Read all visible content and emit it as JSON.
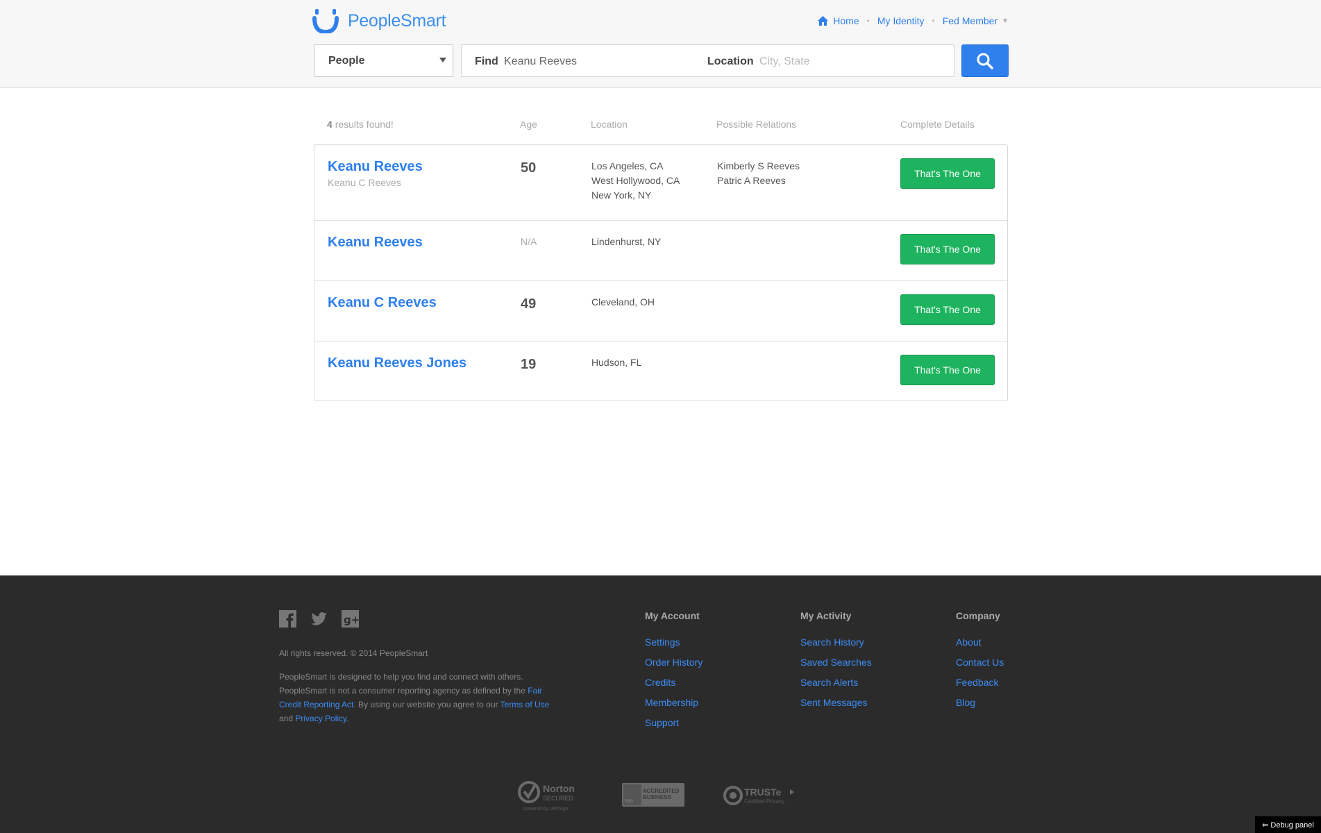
{
  "brand": {
    "name": "PeopleSmart",
    "accent": "#2f80ed",
    "button_green": "#1db35f"
  },
  "topnav": {
    "home": "Home",
    "identity": "My Identity",
    "member": "Fed Member"
  },
  "search": {
    "type_selected": "People",
    "find_label": "Find",
    "find_value": "Keanu Reeves",
    "location_label": "Location",
    "location_placeholder": "City, State"
  },
  "results": {
    "count": "4",
    "count_suffix": "results found!",
    "headers": {
      "age": "Age",
      "location": "Location",
      "relations": "Possible Relations",
      "details": "Complete Details"
    },
    "rows": [
      {
        "name": "Keanu Reeves",
        "aka": "Keanu C Reeves",
        "age": "50",
        "locations": [
          "Los Angeles, CA",
          "West Hollywood, CA",
          "New York, NY"
        ],
        "relations": [
          "Kimberly S Reeves",
          "Patric A Reeves"
        ],
        "button": "That's The One"
      },
      {
        "name": "Keanu Reeves",
        "aka": "",
        "age": "N/A",
        "locations": [
          "Lindenhurst, NY"
        ],
        "relations": [],
        "button": "That's The One"
      },
      {
        "name": "Keanu C Reeves",
        "aka": "",
        "age": "49",
        "locations": [
          "Cleveland, OH"
        ],
        "relations": [],
        "button": "That's The One"
      },
      {
        "name": "Keanu Reeves Jones",
        "aka": "",
        "age": "19",
        "locations": [
          "Hudson, FL"
        ],
        "relations": [],
        "button": "That's The One"
      }
    ]
  },
  "footer": {
    "social_icons": [
      "facebook-icon",
      "twitter-icon",
      "google-plus-icon"
    ],
    "copyright": "All rights reserved. © 2014 PeopleSmart",
    "disclaimer_1": "PeopleSmart is designed to help you find and connect with others. PeopleSmart is not a consumer reporting agency as defined by the ",
    "disclaimer_link_fcra": "Fair Credit Reporting Act",
    "disclaimer_2": ". By using our website you agree to our ",
    "disclaimer_link_terms": "Terms of Use",
    "disclaimer_3": " and ",
    "disclaimer_link_privacy": "Privacy Policy",
    "disclaimer_4": ".",
    "columns": [
      {
        "title": "My Account",
        "links": [
          "Settings",
          "Order History",
          "Credits",
          "Membership",
          "Support"
        ]
      },
      {
        "title": "My Activity",
        "links": [
          "Search History",
          "Saved Searches",
          "Search Alerts",
          "Sent Messages"
        ]
      },
      {
        "title": "Company",
        "links": [
          "About",
          "Contact Us",
          "Feedback",
          "Blog"
        ]
      }
    ],
    "badges": {
      "norton": "Norton",
      "norton_sub": "SECURED",
      "norton_by": "powered by VeriSign",
      "bbb": "ACCREDITED BUSINESS",
      "bbb_mark": "BBB.",
      "truste": "TRUSTe",
      "truste_sub": "Certified Privacy"
    }
  },
  "debug": "⇐ Debug panel"
}
